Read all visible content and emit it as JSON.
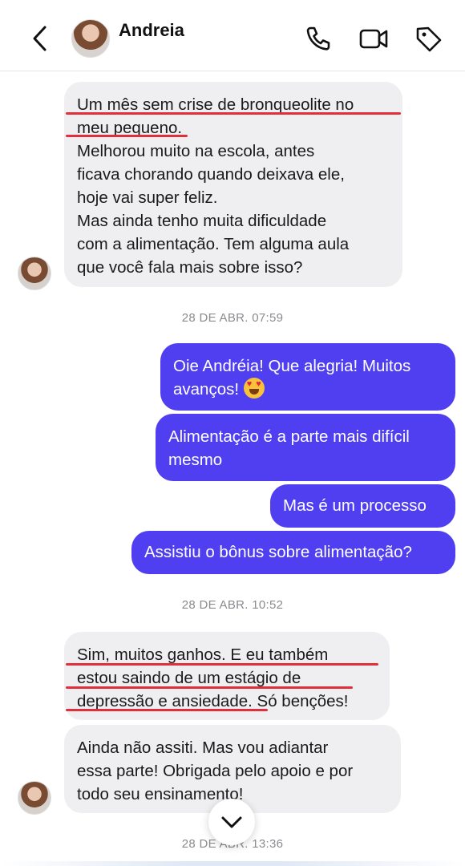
{
  "header": {
    "contact_name": "Andreia",
    "icons": [
      "back-arrow-icon",
      "phone-icon",
      "video-camera-icon",
      "tag-icon"
    ]
  },
  "messages": {
    "m1": "Um mês sem crise de bronqueolite no\nmeu pequeno.\nMelhorou muito na escola, antes\nficava chorando quando deixava ele,\nhoje vai super feliz.\nMas ainda tenho muita dificuldade\ncom a alimentação. Tem alguma aula\nque você fala mais sobre isso?",
    "ts1": "28 DE ABR. 07:59",
    "m2_line1": "Oie Andréia! Que alegria! Muitos",
    "m2_line2": "avanços!",
    "m3": "Alimentação é a parte mais difícil\nmesmo",
    "m4": "Mas é um processo",
    "m5": "Assistiu o bônus sobre alimentação?",
    "ts2": "28 DE ABR. 10:52",
    "m6": "Sim, muitos ganhos. E eu também\nestou saindo de um estágio de\ndepressão e ansiedade. Só benções!",
    "m7": "Ainda não assiti. Mas vou adiantar\nessa parte! Obrigada pelo apoio e por\ntodo seu ensinamento!",
    "ts3": "28 DE ABR. 13:36"
  },
  "colors": {
    "outgoing_bubble": "#4f3ff0",
    "incoming_bubble": "#efeff2",
    "annotation_underline": "#e0303a"
  },
  "emoji": "heart-eyes-emoji-icon"
}
